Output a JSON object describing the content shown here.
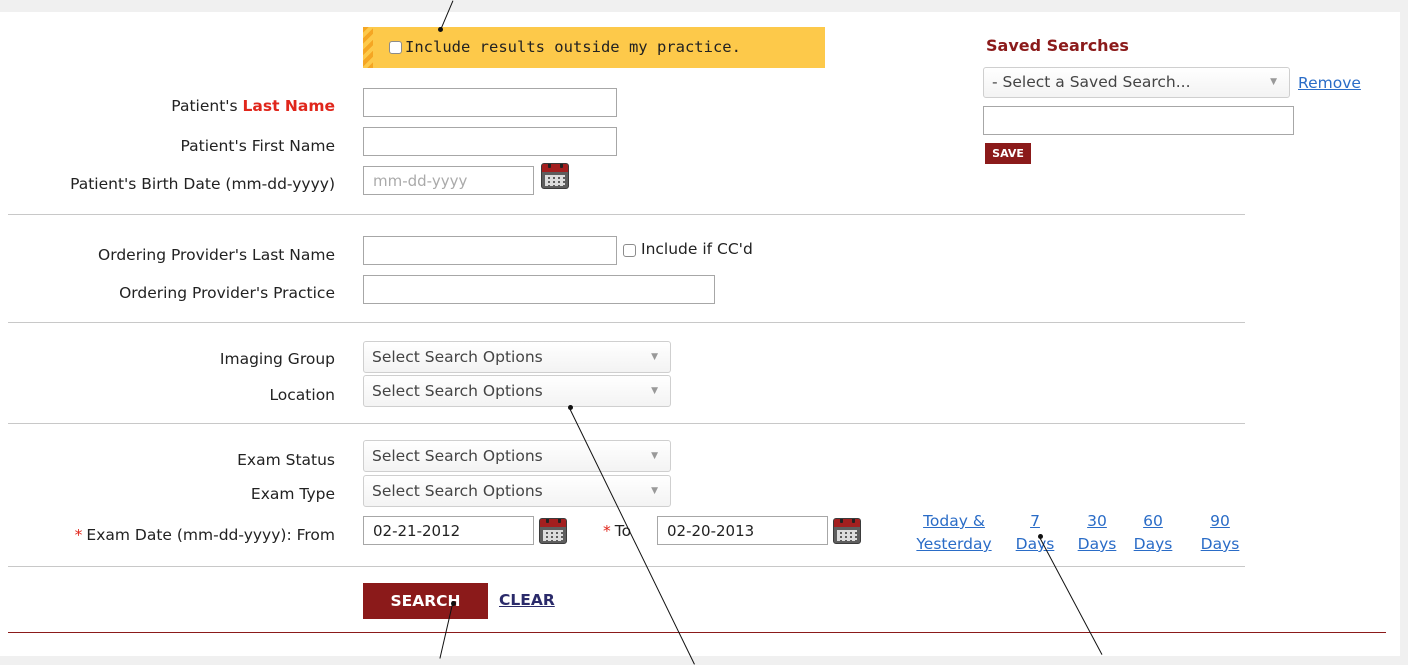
{
  "outside_practice": {
    "label": "Include results outside my practice."
  },
  "saved_searches": {
    "title": "Saved Searches",
    "select_value": "- Select a Saved Search...",
    "remove_label": "Remove",
    "save_label": "SAVE"
  },
  "patient": {
    "last_name_prefix": "Patient's ",
    "last_name_emphasis": "Last Name",
    "first_name_label": "Patient's First Name",
    "birth_date_label": "Patient's Birth Date (mm-dd-yyyy)",
    "birth_date_placeholder": "mm-dd-yyyy"
  },
  "provider": {
    "last_name_label": "Ordering Provider's Last Name",
    "include_cc_label": "Include if CC'd",
    "practice_label": "Ordering Provider's Practice"
  },
  "imaging": {
    "group_label": "Imaging Group",
    "group_value": "Select Search Options",
    "location_label": "Location",
    "location_value": "Select Search Options"
  },
  "exam": {
    "status_label": "Exam Status",
    "status_value": "Select Search Options",
    "type_label": "Exam Type",
    "type_value": "Select Search Options",
    "required_mark": "*",
    "date_label": "Exam Date (mm-dd-yyyy): From",
    "from_value": "02-21-2012",
    "to_label": "To",
    "to_value": "02-20-2013"
  },
  "quick_ranges": [
    {
      "line1": "Today &",
      "line2": "Yesterday"
    },
    {
      "line1": "7",
      "line2": "Days"
    },
    {
      "line1": "30",
      "line2": "Days"
    },
    {
      "line1": "60",
      "line2": "Days"
    },
    {
      "line1": "90",
      "line2": "Days"
    }
  ],
  "actions": {
    "search_label": "SEARCH",
    "clear_label": "CLEAR"
  },
  "colors": {
    "accent": "#8b1a1a",
    "banner": "#fdc94a",
    "link": "#2a6cc7",
    "required": "#e0261b"
  }
}
